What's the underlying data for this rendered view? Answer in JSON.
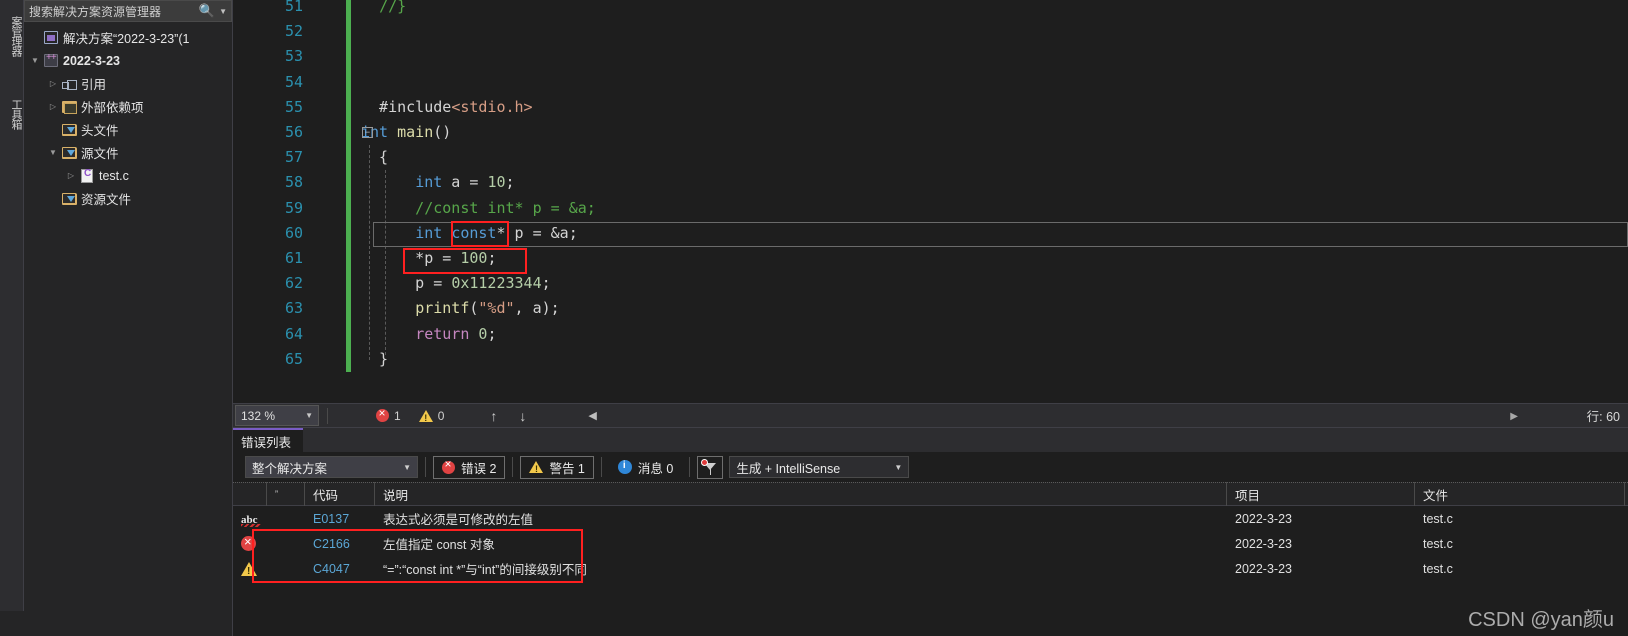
{
  "vertical_tabs": [
    {
      "label": "案管理器"
    },
    {
      "label": "工具箱"
    }
  ],
  "solution_explorer": {
    "search_placeholder": "搜索解决方案资源管理器",
    "search_icon": "magnifier-icon",
    "dropdown_icon": "chevron-down-icon",
    "tree": [
      {
        "label": "解决方案“2022-3-23”(1",
        "icon": "solution-icon",
        "indent": 1,
        "expander": "",
        "bold": false
      },
      {
        "label": "2022-3-23",
        "icon": "project-icon",
        "indent": 1,
        "expander": "▼",
        "bold": true
      },
      {
        "label": "引用",
        "icon": "references-icon",
        "indent": 2,
        "expander": "▷",
        "bold": false
      },
      {
        "label": "外部依赖项",
        "icon": "external-dependencies-icon",
        "indent": 2,
        "expander": "▷",
        "bold": false
      },
      {
        "label": "头文件",
        "icon": "filter-folder-icon",
        "indent": 2,
        "expander": "",
        "bold": false
      },
      {
        "label": "源文件",
        "icon": "filter-folder-icon",
        "indent": 2,
        "expander": "▼",
        "bold": false
      },
      {
        "label": "test.c",
        "icon": "c-file-icon",
        "indent": 3,
        "expander": "▷",
        "bold": false
      },
      {
        "label": "资源文件",
        "icon": "filter-folder-icon",
        "indent": 2,
        "expander": "",
        "bold": false
      }
    ]
  },
  "editor": {
    "lines": [
      {
        "num": "51",
        "segments": [
          {
            "t": "  ",
            "c": "pl"
          },
          {
            "t": "//}",
            "c": "cm"
          }
        ],
        "changed": true
      },
      {
        "num": "52",
        "segments": [],
        "changed": true
      },
      {
        "num": "53",
        "segments": [],
        "changed": true
      },
      {
        "num": "54",
        "segments": [],
        "changed": true
      },
      {
        "num": "55",
        "segments": [
          {
            "t": "  #include",
            "c": "pl"
          },
          {
            "t": "<stdio.h>",
            "c": "inc"
          }
        ],
        "changed": true
      },
      {
        "num": "56",
        "segments": [
          {
            "t": "int",
            "c": "k"
          },
          {
            "t": " ",
            "c": "pl"
          },
          {
            "t": "main",
            "c": "fn"
          },
          {
            "t": "()",
            "c": "pl"
          }
        ],
        "changed": true
      },
      {
        "num": "57",
        "segments": [
          {
            "t": "  {",
            "c": "pl"
          }
        ],
        "changed": true
      },
      {
        "num": "58",
        "segments": [
          {
            "t": "      ",
            "c": "pl"
          },
          {
            "t": "int",
            "c": "k"
          },
          {
            "t": " a = ",
            "c": "pl"
          },
          {
            "t": "10",
            "c": "nm"
          },
          {
            "t": ";",
            "c": "pl"
          }
        ],
        "changed": true
      },
      {
        "num": "59",
        "segments": [
          {
            "t": "      //const int* p = &a;",
            "c": "cm"
          }
        ],
        "changed": true
      },
      {
        "num": "60",
        "segments": [
          {
            "t": "      ",
            "c": "pl"
          },
          {
            "t": "int",
            "c": "k"
          },
          {
            "t": " ",
            "c": "pl"
          },
          {
            "t": "const",
            "c": "k"
          },
          {
            "t": "* p = &a;",
            "c": "pl"
          }
        ],
        "changed": true
      },
      {
        "num": "61",
        "segments": [
          {
            "t": "      *p = ",
            "c": "pl"
          },
          {
            "t": "100",
            "c": "nm"
          },
          {
            "t": ";",
            "c": "pl"
          }
        ],
        "changed": true
      },
      {
        "num": "62",
        "segments": [
          {
            "t": "      p = ",
            "c": "pl"
          },
          {
            "t": "0x11223344",
            "c": "nm"
          },
          {
            "t": ";",
            "c": "pl"
          }
        ],
        "changed": true
      },
      {
        "num": "63",
        "segments": [
          {
            "t": "      ",
            "c": "pl"
          },
          {
            "t": "printf",
            "c": "fn"
          },
          {
            "t": "(",
            "c": "pl"
          },
          {
            "t": "\"%d\"",
            "c": "st"
          },
          {
            "t": ", a);",
            "c": "pl"
          }
        ],
        "changed": true
      },
      {
        "num": "64",
        "segments": [
          {
            "t": "      ",
            "c": "pl"
          },
          {
            "t": "return",
            "c": "kw"
          },
          {
            "t": " ",
            "c": "pl"
          },
          {
            "t": "0",
            "c": "nm"
          },
          {
            "t": ";",
            "c": "pl"
          }
        ],
        "changed": true
      },
      {
        "num": "65",
        "segments": [
          {
            "t": "  }",
            "c": "pl"
          }
        ],
        "changed": true
      }
    ],
    "fold_marker": "─"
  },
  "editor_status": {
    "zoom_value": "132 %",
    "zoom_dropdown_icon": "chevron-down-icon",
    "error_icon": "error-circle-icon",
    "error_count": "1",
    "warning_icon": "warning-triangle-icon",
    "warning_count": "0",
    "up_arrow_icon": "arrow-up-icon",
    "down_arrow_icon": "arrow-down-icon",
    "scroll_left_icon": "caret-left-icon",
    "scroll_right_icon": "caret-right-icon",
    "line_position": "行: 60"
  },
  "error_list": {
    "tab_label": "错误列表",
    "scope_value": "整个解决方案",
    "scope_dropdown_icon": "chevron-down-icon",
    "toggles": [
      {
        "icon": "error-circle-icon",
        "label": "错误 2",
        "active": true
      },
      {
        "icon": "warning-triangle-icon",
        "label": "警告 1",
        "active": true
      },
      {
        "icon": "info-circle-icon",
        "label": "消息 0",
        "active": false
      }
    ],
    "filter_icon": "filter-icon",
    "build_filter_value": "生成 + IntelliSense",
    "build_filter_dropdown_icon": "chevron-down-icon",
    "columns": [
      "",
      "",
      "代码",
      "说明",
      "项目",
      "文件"
    ],
    "rows": [
      {
        "icon": "intellisense-abc-icon",
        "code": "E0137",
        "description": "表达式必须是可修改的左值",
        "project": "2022-3-23",
        "file": "test.c"
      },
      {
        "icon": "error-circle-icon",
        "code": "C2166",
        "description": "左值指定 const 对象",
        "project": "2022-3-23",
        "file": "test.c"
      },
      {
        "icon": "warning-triangle-icon",
        "code": "C4047",
        "description": "“=”:“const int *”与“int”的间接级别不同",
        "project": "2022-3-23",
        "file": "test.c"
      }
    ]
  },
  "watermark": {
    "text": "CSDN @yan颜u"
  },
  "colors": {
    "accent_purple": "#7a5cc6",
    "annotation_red": "#ff2020",
    "error_red": "#e04343",
    "warning_yellow": "#f2c84b",
    "info_blue": "#2f87d8",
    "change_green": "#4caf50",
    "code_keyword_blue": "#569cd6",
    "line_number_blue": "#2b91af"
  }
}
